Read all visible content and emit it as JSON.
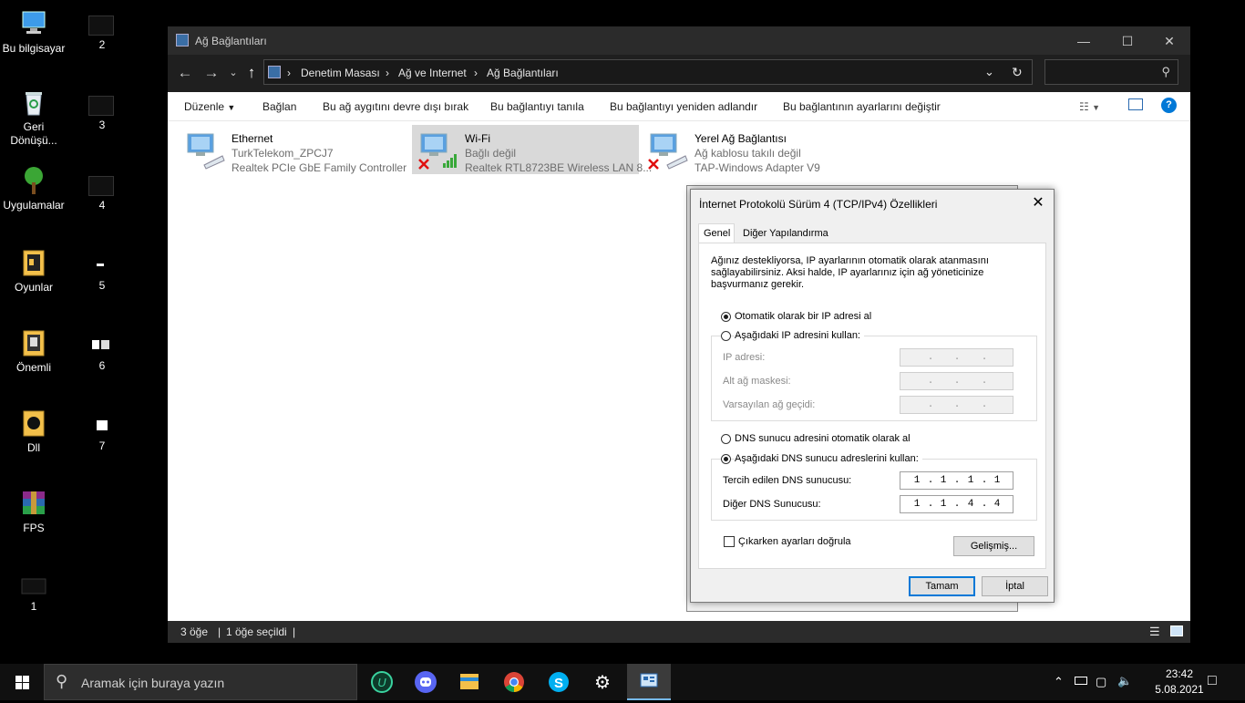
{
  "desktop": {
    "icons": [
      {
        "label": "Bu bilgisayar"
      },
      {
        "label": "Geri Dönüşü..."
      },
      {
        "label": "Uygulamalar"
      },
      {
        "label": "Oyunlar"
      },
      {
        "label": "Önemli"
      },
      {
        "label": "Dll"
      },
      {
        "label": "FPS"
      },
      {
        "label": "1"
      }
    ],
    "thumbs": [
      "2",
      "3",
      "4",
      "5",
      "6",
      "7"
    ]
  },
  "explorer": {
    "title": "Ağ Bağlantıları",
    "breadcrumb": [
      "Denetim Masası",
      "Ağ ve Internet",
      "Ağ Bağlantıları"
    ],
    "search_placeholder": "",
    "toolbar": {
      "organize": "Düzenle",
      "connect": "Bağlan",
      "disable": "Bu ağ aygıtını devre dışı bırak",
      "diagnose": "Bu bağlantıyı tanıla",
      "rename": "Bu bağlantıyı yeniden adlandır",
      "change_settings": "Bu bağlantının ayarlarını değiştir"
    },
    "connections": [
      {
        "name": "Ethernet",
        "status": "TurkTelekom_ZPCJ7",
        "device": "Realtek PCIe GbE Family Controller"
      },
      {
        "name": "Wi-Fi",
        "status": "Bağlı değil",
        "device": "Realtek RTL8723BE Wireless LAN 8..."
      },
      {
        "name": "Yerel Ağ Bağlantısı",
        "status": "Ağ kablosu takılı değil",
        "device": "TAP-Windows Adapter V9"
      }
    ],
    "status": {
      "items": "3 öğe",
      "selected": "1 öğe seçildi"
    }
  },
  "dialog": {
    "title": "İnternet Protokolü Sürüm 4 (TCP/IPv4) Özellikleri",
    "tabs": [
      "Genel",
      "Diğer Yapılandırma"
    ],
    "description": "Ağınız destekliyorsa, IP ayarlarının otomatik olarak atanmasını sağlayabilirsiniz. Aksi halde, IP ayarlarınız için ağ yöneticinize başvurmanız gerekir.",
    "ip_auto": "Otomatik olarak bir IP adresi al",
    "ip_manual": "Aşağıdaki IP adresini kullan:",
    "ip_address_label": "IP adresi:",
    "subnet_label": "Alt ağ maskesi:",
    "gateway_label": "Varsayılan ağ geçidi:",
    "dns_auto": "DNS sunucu adresini otomatik olarak al",
    "dns_manual": "Aşağıdaki DNS sunucu adreslerini kullan:",
    "preferred_dns_label": "Tercih edilen DNS sunucusu:",
    "preferred_dns": [
      "1",
      "1",
      "1",
      "1"
    ],
    "alternate_dns_label": "Diğer DNS Sunucusu:",
    "alternate_dns": [
      "1",
      "1",
      "4",
      "4"
    ],
    "validate_label": "Çıkarken ayarları doğrula",
    "advanced": "Gelişmiş...",
    "ok": "Tamam",
    "cancel": "İptal"
  },
  "taskbar": {
    "search_placeholder": "Aramak için buraya yazın",
    "time": "23:42",
    "date": "5.08.2021"
  },
  "colors": {
    "accent": "#0078d7",
    "taskbar": "#101010",
    "titlebar": "#2b2b2b"
  }
}
